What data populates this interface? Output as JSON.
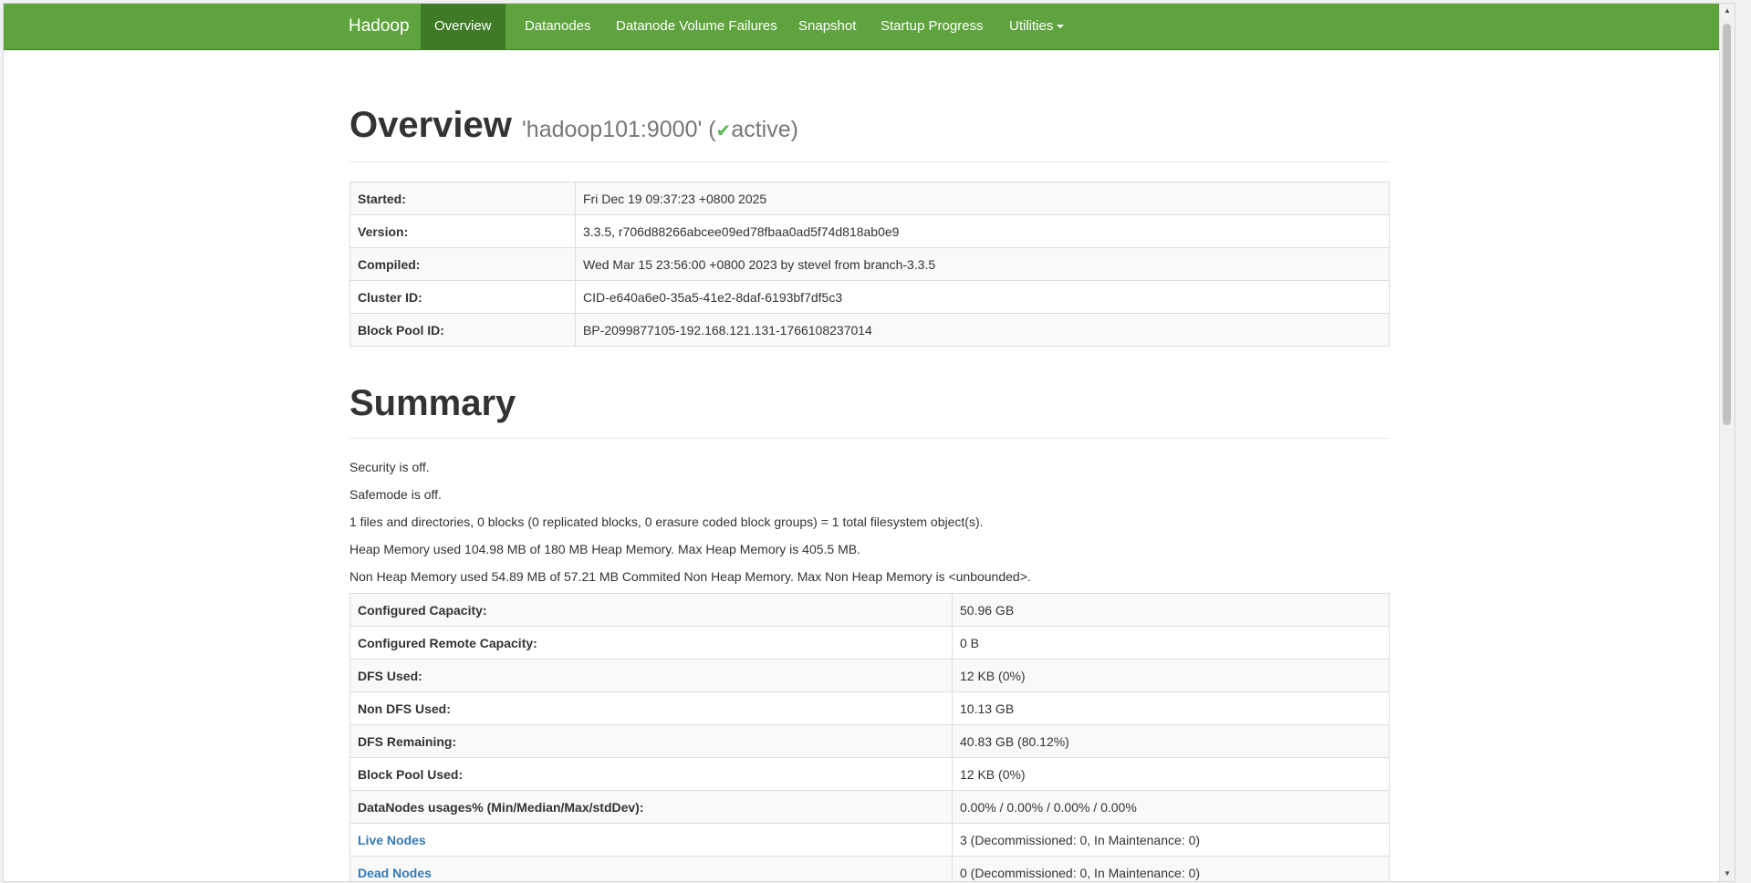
{
  "navbar": {
    "brand": "Hadoop",
    "items": [
      {
        "label": "Overview"
      },
      {
        "label": "Datanodes"
      },
      {
        "label": "Datanode Volume Failures"
      },
      {
        "label": "Snapshot"
      },
      {
        "label": "Startup Progress"
      },
      {
        "label": "Utilities"
      }
    ]
  },
  "overview": {
    "title": "Overview",
    "host": "'hadoop101:9000'",
    "open_paren": "(",
    "check_icon": "✔",
    "state": "active",
    "close_paren": ")",
    "rows": [
      {
        "key": "Started:",
        "value": "Fri Dec 19 09:37:23 +0800 2025"
      },
      {
        "key": "Version:",
        "value": "3.3.5, r706d88266abcee09ed78fbaa0ad5f74d818ab0e9"
      },
      {
        "key": "Compiled:",
        "value": "Wed Mar 15 23:56:00 +0800 2023 by stevel from branch-3.3.5"
      },
      {
        "key": "Cluster ID:",
        "value": "CID-e640a6e0-35a5-41e2-8daf-6193bf7df5c3"
      },
      {
        "key": "Block Pool ID:",
        "value": "BP-2099877105-192.168.121.131-1766108237014"
      }
    ]
  },
  "summary": {
    "title": "Summary",
    "lines": [
      "Security is off.",
      "Safemode is off.",
      "1 files and directories, 0 blocks (0 replicated blocks, 0 erasure coded block groups) = 1 total filesystem object(s).",
      "Heap Memory used 104.98 MB of 180 MB Heap Memory. Max Heap Memory is 405.5 MB.",
      "Non Heap Memory used 54.89 MB of 57.21 MB Commited Non Heap Memory. Max Non Heap Memory is <unbounded>."
    ],
    "rows": [
      {
        "key": "Configured Capacity:",
        "value": "50.96 GB"
      },
      {
        "key": "Configured Remote Capacity:",
        "value": "0 B"
      },
      {
        "key": "DFS Used:",
        "value": "12 KB (0%)"
      },
      {
        "key": "Non DFS Used:",
        "value": "10.13 GB"
      },
      {
        "key": "DFS Remaining:",
        "value": "40.83 GB (80.12%)"
      },
      {
        "key": "Block Pool Used:",
        "value": "12 KB (0%)"
      },
      {
        "key": "DataNodes usages% (Min/Median/Max/stdDev):",
        "value": "0.00% / 0.00% / 0.00% / 0.00%"
      },
      {
        "key": "Live Nodes",
        "value": "3 (Decommissioned: 0, In Maintenance: 0)"
      },
      {
        "key": "Dead Nodes",
        "value": "0 (Decommissioned: 0, In Maintenance: 0)"
      }
    ]
  },
  "colors": {
    "navbar": "#5fa33e",
    "navbar_active": "#3f7a26",
    "link": "#337ab7",
    "check": "#5cb85c"
  }
}
